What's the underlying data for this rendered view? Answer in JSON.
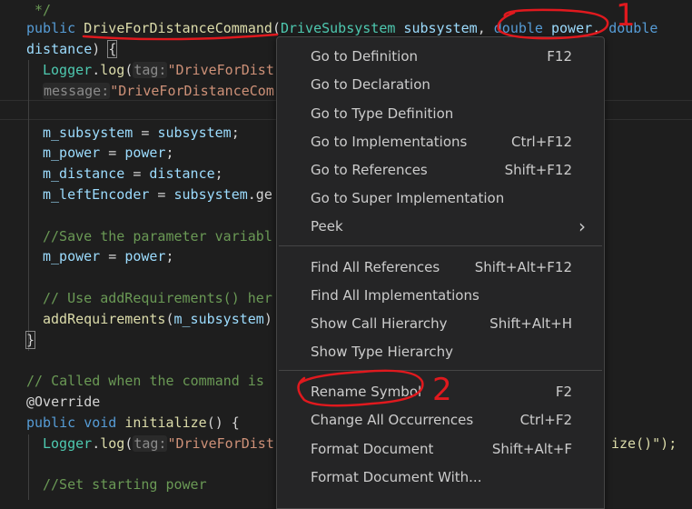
{
  "code": {
    "comment_end": " */",
    "l2": {
      "kw": "public ",
      "fn": "DriveForDistanceCommand",
      "p1": "(",
      "ty": "DriveSubsystem",
      "v1": " subsystem",
      ",": ", ",
      "kw2": "double",
      "v2": " power",
      ",2": ", ",
      "kw3": "double"
    },
    "l3": {
      "v": "distance",
      "p": ") ",
      "b": "{"
    },
    "l4": {
      "fn": "Logger",
      "p": ".",
      "fn2": "log",
      "p2": "(",
      "hint": "tag:",
      "st": "\"DriveForDist"
    },
    "l5": {
      "hint": "message:",
      "st": "\"DriveForDistanceCom"
    },
    "l7": {
      "v": "m_subsystem",
      "p": " = ",
      "v2": "subsystem",
      "e": ";"
    },
    "l8": {
      "v": "m_power",
      "p": " = ",
      "v2": "power",
      "e": ";"
    },
    "l9": {
      "v": "m_distance",
      "p": " = ",
      "v2": "distance",
      "e": ";"
    },
    "l10": {
      "v": "m_leftEncoder",
      "p": " = ",
      "v2": "subsystem",
      "e": ".ge"
    },
    "l12": "//Save the parameter variabl",
    "l13": {
      "v": "m_power",
      "p": " = ",
      "v2": "power",
      "e": ";"
    },
    "l15": "// Use addRequirements() her",
    "l16": {
      "fn": "addRequirements",
      "p": "(",
      "v": "m_subsystem",
      "e": ")"
    },
    "l17": "}",
    "l19": "// Called when the command is",
    "l20": "@Override",
    "l21": {
      "kw": "public ",
      "kw2": "void ",
      "fn": "initialize",
      "p": "() {"
    },
    "l22": {
      "fn": "Logger",
      "p": ".",
      "fn2": "log",
      "p2": "(",
      "hint": "tag:",
      "st": "\"DriveForDist",
      "tail": "ize()\");"
    },
    "l24": "//Set starting power"
  },
  "menu": {
    "items": [
      {
        "label": "Go to Definition",
        "shortcut": "F12"
      },
      {
        "label": "Go to Declaration",
        "shortcut": ""
      },
      {
        "label": "Go to Type Definition",
        "shortcut": ""
      },
      {
        "label": "Go to Implementations",
        "shortcut": "Ctrl+F12"
      },
      {
        "label": "Go to References",
        "shortcut": "Shift+F12"
      },
      {
        "label": "Go to Super Implementation",
        "shortcut": ""
      },
      {
        "label": "Peek",
        "shortcut": ""
      },
      {
        "label": "Find All References",
        "shortcut": "Shift+Alt+F12"
      },
      {
        "label": "Find All Implementations",
        "shortcut": ""
      },
      {
        "label": "Show Call Hierarchy",
        "shortcut": "Shift+Alt+H"
      },
      {
        "label": "Show Type Hierarchy",
        "shortcut": ""
      },
      {
        "label": "Rename Symbol",
        "shortcut": "F2"
      },
      {
        "label": "Change All Occurrences",
        "shortcut": "Ctrl+F2"
      },
      {
        "label": "Format Document",
        "shortcut": "Shift+Alt+F"
      },
      {
        "label": "Format Document With...",
        "shortcut": ""
      }
    ],
    "peek_chevron": "›"
  },
  "annotations": {
    "one": "1",
    "two": "2",
    "color": "#e0191e"
  }
}
